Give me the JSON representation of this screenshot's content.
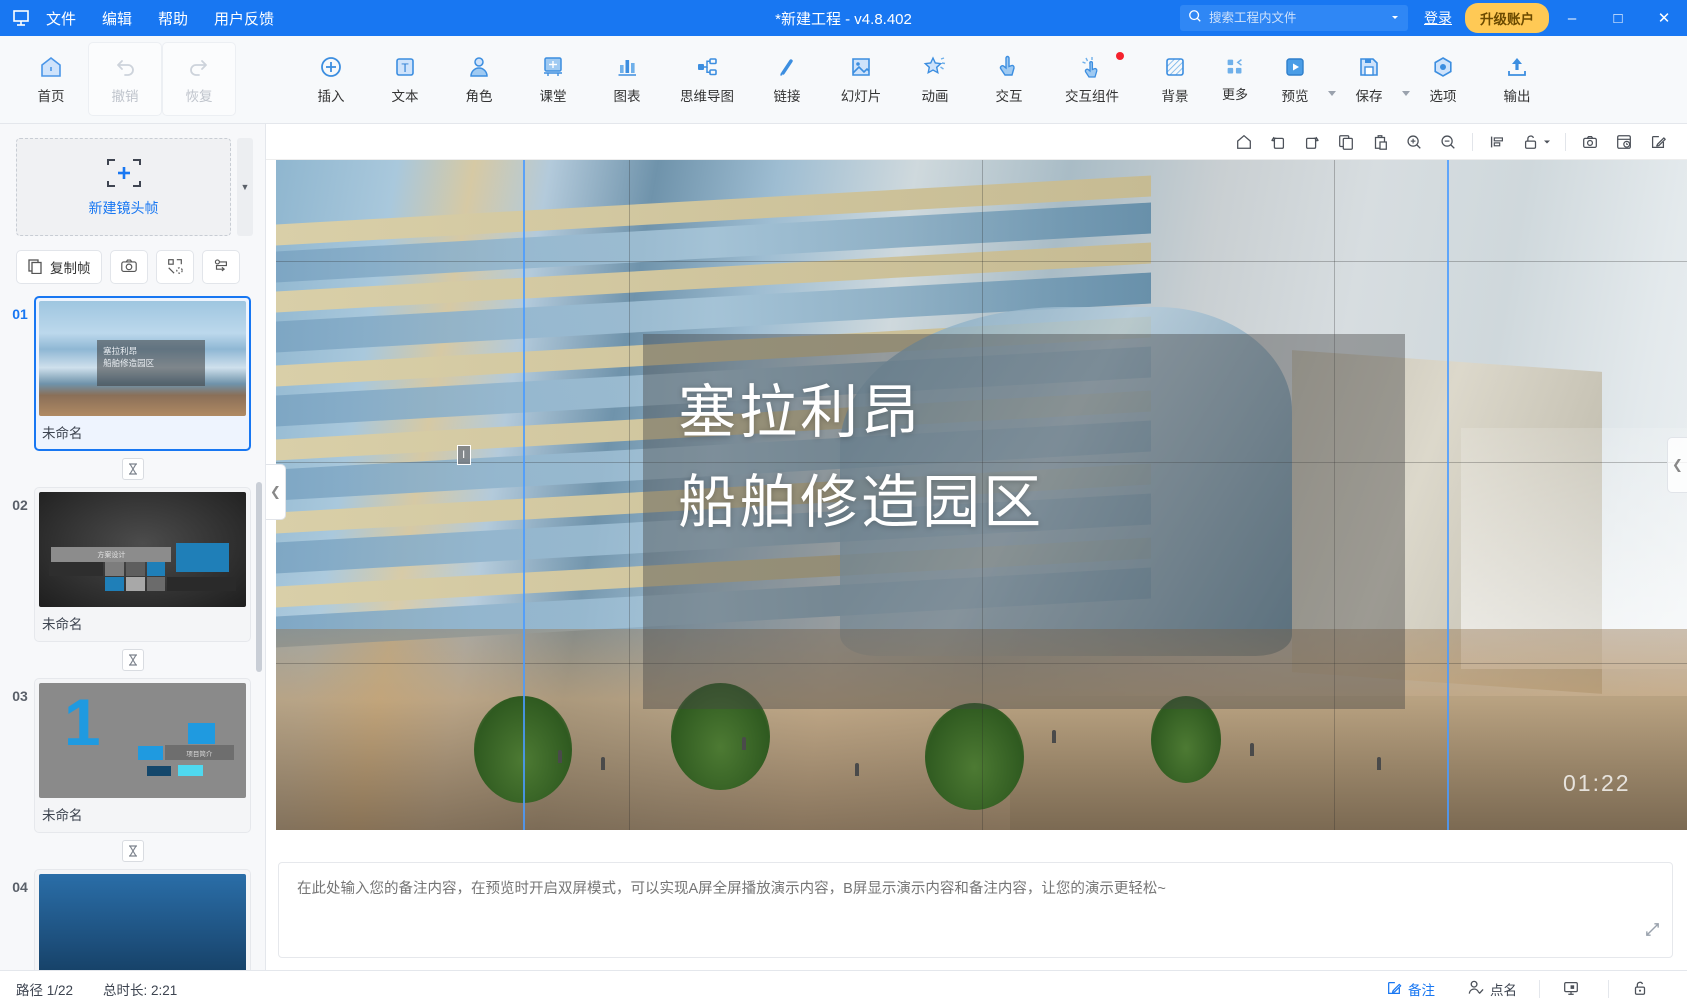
{
  "titlebar": {
    "logo_icon": "app-logo-icon",
    "menus": [
      "文件",
      "编辑",
      "帮助",
      "用户反馈"
    ],
    "doc_title": "*新建工程 - v4.8.402",
    "search": {
      "placeholder": "搜索工程内文件",
      "value": "",
      "icon": "search-icon",
      "caret_icon": "chevron-down-icon"
    },
    "login_label": "登录",
    "upgrade_label": "升级账户",
    "minimize_icon": "minimize-icon",
    "maximize_icon": "maximize-icon",
    "close_icon": "close-icon",
    "accent": "#1877f2",
    "upgrade_color": "#ffc955"
  },
  "ribbon": {
    "groups": [
      {
        "items": [
          {
            "label": "首页",
            "icon": "home-icon",
            "state": "normal"
          },
          {
            "label": "撤销",
            "icon": "undo-icon",
            "state": "disabled"
          },
          {
            "label": "恢复",
            "icon": "redo-icon",
            "state": "disabled"
          }
        ]
      },
      {
        "items": [
          {
            "label": "插入",
            "icon": "plus-circle-icon",
            "state": "normal"
          },
          {
            "label": "文本",
            "icon": "text-box-icon",
            "state": "normal"
          },
          {
            "label": "角色",
            "icon": "avatar-icon",
            "state": "normal"
          },
          {
            "label": "课堂",
            "icon": "classroom-icon",
            "state": "normal"
          },
          {
            "label": "图表",
            "icon": "bar-chart-icon",
            "state": "normal"
          },
          {
            "label": "思维导图",
            "icon": "mindmap-icon",
            "state": "normal"
          },
          {
            "label": "链接",
            "icon": "link-icon",
            "state": "normal"
          },
          {
            "label": "幻灯片",
            "icon": "slide-image-icon",
            "state": "normal"
          },
          {
            "label": "动画",
            "icon": "animation-star-icon",
            "state": "normal"
          },
          {
            "label": "交互",
            "icon": "hand-tap-icon",
            "state": "normal"
          },
          {
            "label": "交互组件",
            "icon": "interactive-component-icon",
            "state": "normal",
            "badge": true
          },
          {
            "label": "背景",
            "icon": "background-icon",
            "state": "normal"
          },
          {
            "label": "更多",
            "icon": "more-grid-icon",
            "state": "normal"
          }
        ]
      },
      {
        "items": [
          {
            "label": "预览",
            "icon": "play-preview-icon",
            "state": "normal",
            "caret": true
          },
          {
            "label": "保存",
            "icon": "save-disk-icon",
            "state": "normal",
            "caret": true
          },
          {
            "label": "选项",
            "icon": "options-gear-icon",
            "state": "normal"
          },
          {
            "label": "输出",
            "icon": "export-upload-icon",
            "state": "normal"
          }
        ]
      }
    ]
  },
  "left_panel": {
    "new_frame_label": "新建镜头帧",
    "new_frame_icon": "add-frame-icon",
    "scroll_caret_icon": "chevron-down-icon",
    "actions": [
      {
        "label": "复制帧",
        "icon": "copy-frame-icon"
      },
      {
        "label": "",
        "icon": "camera-icon"
      },
      {
        "label": "",
        "icon": "fit-frame-icon"
      },
      {
        "label": "",
        "icon": "reorder-path-icon"
      }
    ],
    "transition_icon": "hourglass-transition-icon",
    "slides": [
      {
        "num": "01",
        "name": "未命名",
        "thumb": "th1",
        "active": true,
        "thumb_text": [
          "塞拉利昂",
          "船舶修造园区"
        ]
      },
      {
        "num": "02",
        "name": "未命名",
        "thumb": "th2",
        "thumb_text": [
          "方案设计"
        ]
      },
      {
        "num": "03",
        "name": "未命名",
        "thumb": "th3",
        "thumb_text": [
          "项目简介"
        ]
      },
      {
        "num": "04",
        "name": "",
        "thumb": "th4",
        "thumb_text": []
      }
    ]
  },
  "canvas_toolbar": {
    "buttons": [
      {
        "icon": "home-outline-icon",
        "name": "reset-view-button"
      },
      {
        "icon": "rotate-left-icon",
        "name": "rotate-left-button"
      },
      {
        "icon": "rotate-right-icon",
        "name": "rotate-right-button"
      },
      {
        "icon": "copy-icon",
        "name": "copy-button"
      },
      {
        "icon": "paste-icon",
        "name": "paste-button"
      },
      {
        "icon": "zoom-in-icon",
        "name": "zoom-in-button"
      },
      {
        "icon": "zoom-out-icon",
        "name": "zoom-out-button"
      },
      {
        "icon": "align-icon",
        "name": "align-button"
      },
      {
        "icon": "unlock-icon",
        "name": "lock-button",
        "caret": true
      },
      {
        "icon": "snapshot-icon",
        "name": "snapshot-button"
      },
      {
        "icon": "timeline-icon",
        "name": "timeline-button"
      },
      {
        "icon": "edit-icon",
        "name": "edit-button"
      }
    ]
  },
  "stage": {
    "slide_title_lines": [
      "塞拉利昂",
      "船舶修造园区"
    ],
    "timestamp": "01:22",
    "collapse_left_icon": "chevron-left-icon",
    "collapse_right_icon": "chevron-left-icon",
    "handle_icon": "resize-handle-icon"
  },
  "notes": {
    "placeholder": "在此处输入您的备注内容，在预览时开启双屏模式，可以实现A屏全屏播放演示内容，B屏显示演示内容和备注内容，让您的演示更轻松~",
    "value": "",
    "expand_icon": "expand-icon"
  },
  "statusbar": {
    "path_label": "路径 1/22",
    "duration_label": "总时长: 2:21",
    "right_items": [
      {
        "label": "备注",
        "icon": "notes-edit-icon",
        "accent": true
      },
      {
        "label": "点名",
        "icon": "roll-call-icon",
        "accent": false
      },
      {
        "label": "",
        "icon": "presenter-screen-icon",
        "accent": false
      },
      {
        "label": "",
        "icon": "lock-small-icon",
        "accent": false
      }
    ]
  }
}
